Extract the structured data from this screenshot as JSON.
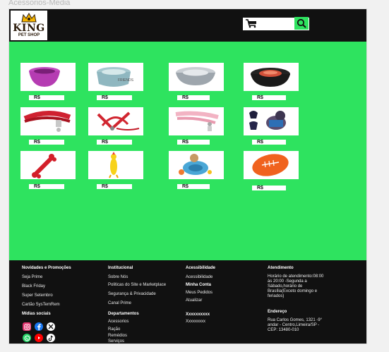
{
  "frame_title": "Acessorios-Media",
  "header": {
    "logo_top": "KING",
    "logo_bottom": "PET SHOP",
    "search_placeholder": ""
  },
  "products": [
    {
      "name": "bowl-purple",
      "price": "R$"
    },
    {
      "name": "bowl-printed",
      "price": "R$"
    },
    {
      "name": "bowl-steel",
      "price": "R$"
    },
    {
      "name": "bowl-red-steel",
      "price": "R$"
    },
    {
      "name": "collar-red",
      "price": "R$"
    },
    {
      "name": "harness-red",
      "price": "R$"
    },
    {
      "name": "collar-pink",
      "price": "R$"
    },
    {
      "name": "harness-dog",
      "price": "R$"
    },
    {
      "name": "toy-bone-red",
      "price": "R$"
    },
    {
      "name": "toy-chicken",
      "price": "R$"
    },
    {
      "name": "toy-ball-feeder",
      "price": "R$"
    },
    {
      "name": "toy-football",
      "price": "R$"
    }
  ],
  "footer": {
    "col1": {
      "title": "Novidades e Promoções",
      "items": [
        "Seja Prime",
        "Black Friday",
        "Super Setembro",
        "Cartão SysTemRem"
      ],
      "social_title": "Mídias sociais"
    },
    "col2": {
      "title": "Institucional",
      "items": [
        "Sobre  Nós",
        "Politicas do Site e Marketplace",
        "Segurança & Privacidade",
        "Canal Prime"
      ],
      "dept_title": "Departamentos",
      "dept_items": [
        "Acessorios",
        "Ração",
        "Remédios",
        "Serviços"
      ]
    },
    "col3": {
      "title": "Acessibilidade",
      "items": [
        "Acessibilidade"
      ],
      "account_title": "Minha Conta",
      "account_items": [
        "Meus Pedidos",
        "Atualizar"
      ],
      "x_title": "Xxxxxxxxxx",
      "x_item": "Xxxxxxxxx"
    },
    "col4": {
      "title": "Atendimento",
      "hours": "Horário de atendimento:08:00 às 20:00 -Segunda a Sábado,horário de Brasília(Exceto domingo e feriados)",
      "address_title": "Endereço",
      "address": "Rua Carlos Gomes, 1321 -9° andar - Centro,Limeira/SP - CEP: 13480-010"
    }
  },
  "colors": {
    "accent": "#2ee35f",
    "dark": "#111111"
  }
}
